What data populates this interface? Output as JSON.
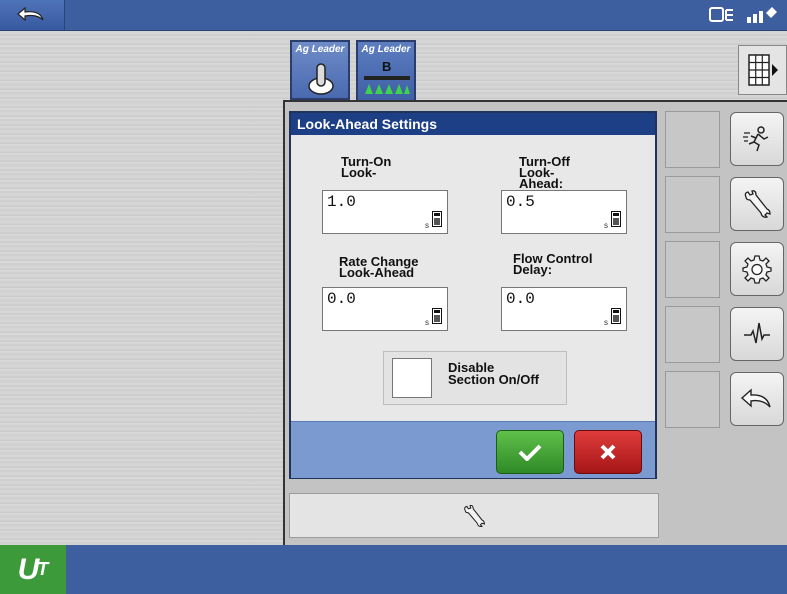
{
  "tabs": [
    {
      "brand": "Ag Leader",
      "icon": "master-switch-icon"
    },
    {
      "brand": "Ag Leader",
      "badge": "B",
      "icon": "sprayer-boom-icon"
    }
  ],
  "dialog": {
    "title": "Look-Ahead Settings",
    "fields": [
      {
        "label_line1": "Turn-On",
        "label_line2": "Look-",
        "label_line3": "",
        "value": "1.0",
        "unit": "s"
      },
      {
        "label_line1": "Turn-Off",
        "label_line2": "Look-",
        "label_line3": "Ahead:",
        "value": "0.5",
        "unit": "s"
      },
      {
        "label_line1": "Rate Change",
        "label_line2": "Look-Ahead",
        "label_line3": "",
        "value": "0.0",
        "unit": "s"
      },
      {
        "label_line1": "Flow Control",
        "label_line2": "Delay:",
        "label_line3": "",
        "value": "0.0",
        "unit": "s"
      }
    ],
    "disable_checkbox": {
      "label_line1": "Disable",
      "label_line2": "Section On/Off",
      "checked": false
    }
  },
  "bottom_bar": {
    "logo_main": "U",
    "logo_sub": "T"
  },
  "colors": {
    "header_blue": "#3d5fa0",
    "dialog_title": "#1d3f86",
    "ok_green": "#3a9a2e",
    "cancel_red": "#c21e1e",
    "ut_green": "#3d9a3a"
  }
}
